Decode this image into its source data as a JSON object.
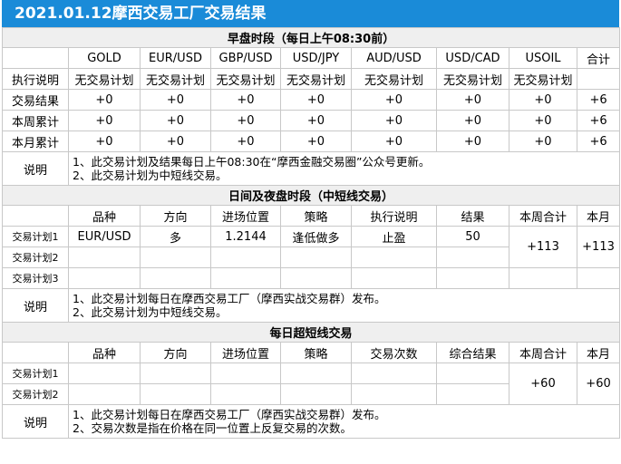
{
  "title": "2021.01.12摩西交易工厂交易结果",
  "morning": {
    "heading": "早盘时段（每日上午08:30前）",
    "columns": [
      "GOLD",
      "EUR/USD",
      "GBP/USD",
      "USD/JPY",
      "AUD/USD",
      "USD/CAD",
      "USOIL",
      "合计"
    ],
    "rows": [
      {
        "label": "执行说明",
        "cells": [
          "无交易计划",
          "无交易计划",
          "无交易计划",
          "无交易计划",
          "无交易计划",
          "无交易计划",
          "无交易计划",
          ""
        ]
      },
      {
        "label": "交易结果",
        "cells": [
          "+0",
          "+0",
          "+0",
          "+0",
          "+0",
          "+0",
          "+0",
          "+6"
        ]
      },
      {
        "label": "本周累计",
        "cells": [
          "+0",
          "+0",
          "+0",
          "+0",
          "+0",
          "+0",
          "+0",
          "+6"
        ]
      },
      {
        "label": "本月累计",
        "cells": [
          "+0",
          "+0",
          "+0",
          "+0",
          "+0",
          "+0",
          "+0",
          "+6"
        ]
      }
    ],
    "note_label": "说明",
    "notes": [
      "1、此交易计划及结果每日上午08:30在“摩西金融交易圈”公众号更新。",
      "2、此交易计划为中短线交易。"
    ]
  },
  "daytime": {
    "heading": "日间及夜盘时段（中短线交易）",
    "columns": [
      "品种",
      "方向",
      "进场位置",
      "策略",
      "执行说明",
      "结果",
      "本周合计",
      "本月"
    ],
    "plans": [
      {
        "label": "交易计划1",
        "cells": [
          "EUR/USD",
          "多",
          "1.2144",
          "逢低做多",
          "止盈",
          "50"
        ]
      },
      {
        "label": "交易计划2",
        "cells": [
          "",
          "",
          "",
          "",
          "",
          ""
        ]
      },
      {
        "label": "交易计划3",
        "cells": [
          "",
          "",
          "",
          "",
          "",
          ""
        ]
      }
    ],
    "week_total": "+113",
    "month_total": "+113",
    "note_label": "说明",
    "notes": [
      "1、此交易计划每日在摩西交易工厂（摩西实战交易群）发布。",
      "2、此交易计划为中短线交易。"
    ]
  },
  "scalp": {
    "heading": "每日超短线交易",
    "columns": [
      "品种",
      "方向",
      "进场位置",
      "策略",
      "交易次数",
      "综合结果",
      "本周合计",
      "本月"
    ],
    "plans": [
      {
        "label": "交易计划1",
        "cells": [
          "",
          "",
          "",
          "",
          "",
          ""
        ]
      },
      {
        "label": "交易计划2",
        "cells": [
          "",
          "",
          "",
          "",
          "",
          ""
        ]
      }
    ],
    "week_total": "+60",
    "month_total": "+60",
    "note_label": "说明",
    "notes": [
      "1、此交易计划每日在摩西交易工厂（摩西实战交易群）发布。",
      "2、交易次数是指在价格在同一位置上反复交易的次数。"
    ]
  }
}
